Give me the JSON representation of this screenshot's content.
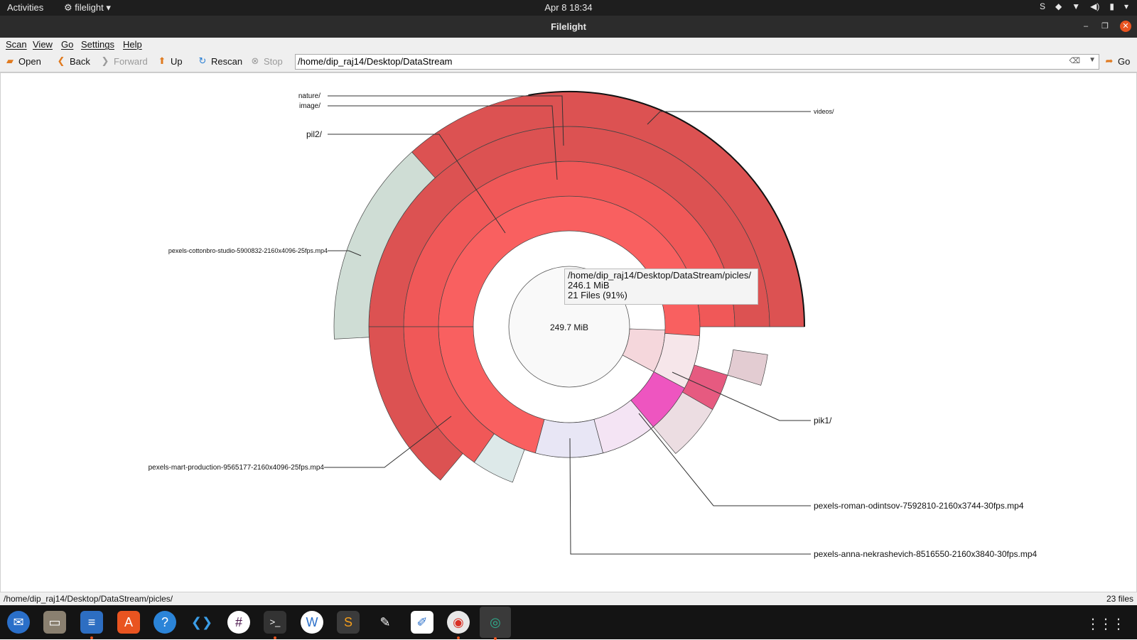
{
  "topbar": {
    "activities": "Activities",
    "app_menu": "filelight ▾",
    "clock": "Apr 8  18:34"
  },
  "window": {
    "title": "Filelight"
  },
  "menu": {
    "scan": "Scan",
    "view": "View",
    "go": "Go",
    "settings": "Settings",
    "help": "Help"
  },
  "toolbar": {
    "open": "Open",
    "back": "Back",
    "forward": "Forward",
    "up": "Up",
    "rescan": "Rescan",
    "stop": "Stop",
    "location": "/home/dip_raj14/Desktop/DataStream",
    "go": "Go"
  },
  "map": {
    "center_size": "249.7 MiB",
    "labels": {
      "nature": "nature/",
      "image": "image/",
      "pil2": "pil2/",
      "videos": "videos/",
      "cottonbro": "pexels-cottonbro-studio-5900832-2160x4096-25fps.mp4",
      "mart": "pexels-mart-production-9565177-2160x4096-25fps.mp4",
      "pik1": "pik1/",
      "roman": "pexels-roman-odintsov-7592810-2160x3744-30fps.mp4",
      "anna": "pexels-anna-nekrashevich-8516550-2160x3840-30fps.mp4"
    },
    "tooltip": {
      "path": "/home/dip_raj14/Desktop/DataStream/picles/",
      "size": "246.1 MiB",
      "files": "21 Files (91%)"
    }
  },
  "status": {
    "path": "/home/dip_raj14/Desktop/DataStream/picles/",
    "count": "23 files"
  },
  "colors": {
    "red_inner": "#f96060",
    "red_mid": "#f05858",
    "red_outer": "#dc5252",
    "pink": "#ee55c0"
  }
}
